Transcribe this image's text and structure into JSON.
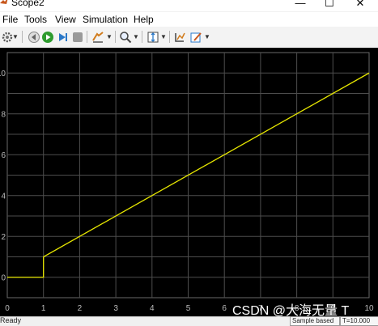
{
  "window": {
    "title": "Scope2",
    "minimize": "—",
    "maximize": "☐",
    "close": "✕"
  },
  "menu": [
    "File",
    "Tools",
    "View",
    "Simulation",
    "Help"
  ],
  "toolbar": [
    "settings-icon",
    "back-step-icon",
    "run-icon",
    "step-forward-icon",
    "stop-icon",
    "highlight-icon",
    "zoom-icon",
    "autoscale-icon",
    "cursor-measure-icon",
    "properties-icon"
  ],
  "status": {
    "left": "Ready",
    "sample": "Sample based",
    "time": "T=10.000"
  },
  "watermark": "CSDN @大海无量 T",
  "colors": {
    "plot_bg": "#000000",
    "grid": "#4d4d4d",
    "trace": "#e6e600",
    "tick": "#bdbdbd"
  },
  "chart_data": {
    "type": "line",
    "title": "",
    "xlabel": "",
    "ylabel": "",
    "xlim": [
      0,
      10
    ],
    "ylim": [
      -1,
      11
    ],
    "xticks": [
      0,
      1,
      2,
      3,
      4,
      5,
      6,
      7,
      8,
      9,
      10
    ],
    "yticks": [
      0,
      2,
      4,
      6,
      8,
      10
    ],
    "grid": true,
    "series": [
      {
        "x": [
          0,
          1,
          1,
          10
        ],
        "y": [
          0,
          0,
          1,
          10
        ]
      }
    ]
  }
}
